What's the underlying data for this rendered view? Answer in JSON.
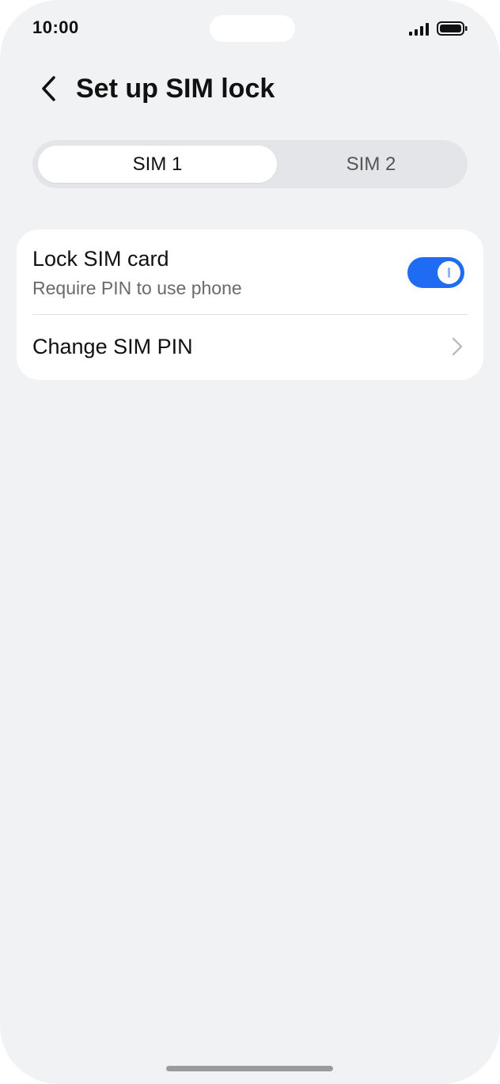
{
  "status_bar": {
    "time": "10:00",
    "signal_icon": "cellular-signal-icon",
    "battery_icon": "battery-icon"
  },
  "header": {
    "back_icon": "chevron-left-icon",
    "title": "Set up SIM lock"
  },
  "sim_tabs": [
    {
      "label": "SIM 1",
      "selected": true
    },
    {
      "label": "SIM 2",
      "selected": false
    }
  ],
  "settings": {
    "lock_sim": {
      "title": "Lock SIM card",
      "subtitle": "Require PIN to use phone",
      "enabled": true
    },
    "change_pin": {
      "label": "Change SIM PIN",
      "icon": "chevron-right-icon"
    }
  },
  "colors": {
    "accent": "#1f6cf2",
    "background": "#f1f2f4",
    "card": "#ffffff"
  }
}
